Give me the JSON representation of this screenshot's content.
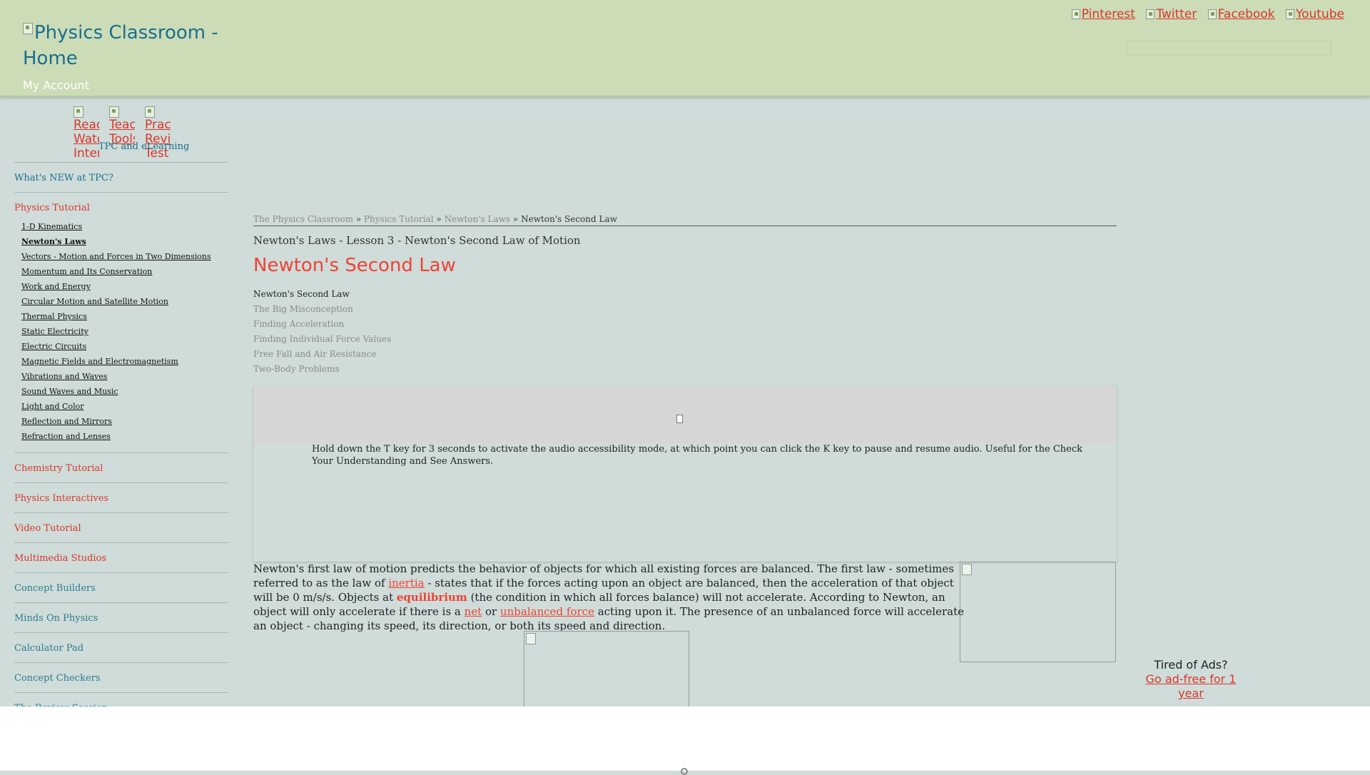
{
  "header": {
    "logo_alt": "Physics Classroom - Home",
    "my_account": "My Account",
    "social": [
      {
        "label": "Pinterest",
        "icon": "pinterest-icon"
      },
      {
        "label": "Twitter",
        "icon": "twitter-icon"
      },
      {
        "label": "Facebook",
        "icon": "facebook-icon"
      },
      {
        "label": "Youtube",
        "icon": "youtube-icon"
      }
    ]
  },
  "sidebar": {
    "quick_icons": [
      {
        "label": "Read Watch Interact"
      },
      {
        "label": "Teacher Tools"
      },
      {
        "label": "Practice Review Test"
      }
    ],
    "tpc_elearning": "TPC and eLearning",
    "whats_new": "What's NEW at TPC?",
    "physics_tutorial": "Physics Tutorial",
    "tutorial_items": [
      "1-D Kinematics",
      "Newton's Laws",
      "Vectors - Motion and Forces in Two Dimensions",
      "Momentum and Its Conservation",
      "Work and Energy",
      "Circular Motion and Satellite Motion",
      "Thermal Physics",
      "Static Electricity",
      "Electric Circuits",
      "Magnetic Fields and Electromagnetism",
      "Vibrations and Waves",
      "Sound Waves and Music",
      "Light and Color",
      "Reflection and Mirrors",
      "Refraction and Lenses"
    ],
    "sections": [
      {
        "label": "Chemistry Tutorial"
      },
      {
        "label": "Physics Interactives"
      },
      {
        "label": "Video Tutorial"
      },
      {
        "label": "Multimedia Studios"
      },
      {
        "label": "Concept Builders"
      },
      {
        "label": "Minds On Physics"
      },
      {
        "label": "Calculator Pad"
      },
      {
        "label": "Concept Checkers"
      },
      {
        "label": "The Review Session"
      }
    ]
  },
  "main": {
    "breadcrumb": {
      "crumbs": [
        "The Physics Classroom",
        "Physics Tutorial",
        "Newton's Laws"
      ],
      "current": "Newton's Second Law",
      "separator": "»"
    },
    "lesson_label": "Newton's Laws - Lesson 3 - Newton's Second Law of Motion",
    "title": "Newton's Second Law",
    "toc": [
      "Newton's Second Law",
      "The Big Misconception",
      "Finding Acceleration",
      "Finding Individual Force Values",
      "Free Fall and Air Resistance",
      "Two-Body Problems"
    ],
    "audio_hint": "Hold down the T key for 3 seconds to activate the audio accessibility mode, at which point you can click the K key to pause and resume audio. Useful for the Check Your Understanding and See Answers.",
    "body": {
      "p1": "Newton's first law of motion predicts the behavior of objects for which all existing forces are balanced. The first law - sometimes referred to as the law of ",
      "link_inertia": "inertia",
      "p2": " - states that if the forces acting upon an object are balanced, then the acceleration of that object will be 0 m/s/s. Objects at ",
      "strong_equilibrium": "equilibrium",
      "p3": " (the condition in which all forces balance) will not accelerate. According to Newton, an object will only accelerate if there is a ",
      "link_net": "net",
      "p4": " or ",
      "link_unbalanced": "unbalanced force",
      "p5": " acting upon it. The presence of an unbalanced force will accelerate an object - changing its speed, its direction, or both its speed and direction."
    }
  },
  "adfree": {
    "question": "Tired of Ads?",
    "link": "Go ad-free for 1 year"
  },
  "colors": {
    "page_bg": "#cfdcd9",
    "header_bg": "#ccdcb7",
    "accent_red": "#ee4236",
    "link_teal": "#1a6e8e"
  }
}
